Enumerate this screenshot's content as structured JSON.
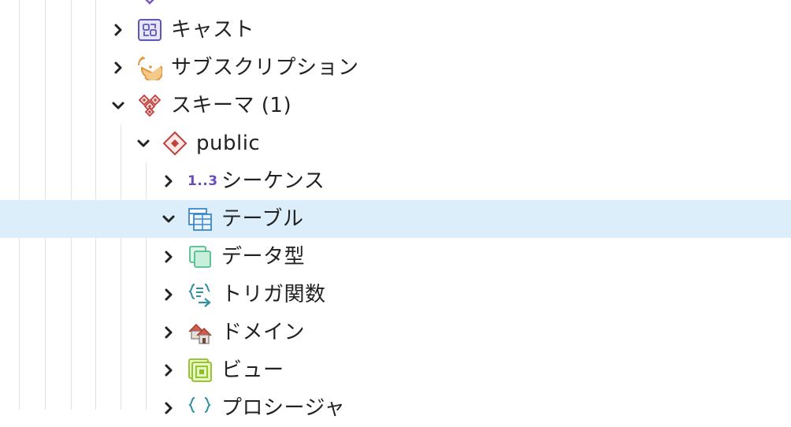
{
  "tree": {
    "items": [
      {
        "label": "キャスト",
        "icon": "cast-icon",
        "expanded": false
      },
      {
        "label": "サブスクリプション",
        "icon": "subscription-icon",
        "expanded": false
      },
      {
        "label": "スキーマ (1)",
        "icon": "schemas-icon",
        "expanded": true
      },
      {
        "label": "public",
        "icon": "schema-icon",
        "expanded": true
      },
      {
        "label": "シーケンス",
        "icon": "sequence-icon",
        "icon_text": "1..3",
        "expanded": false
      },
      {
        "label": "テーブル",
        "icon": "table-icon",
        "expanded": true,
        "selected": true
      },
      {
        "label": "データ型",
        "icon": "datatype-icon",
        "expanded": false
      },
      {
        "label": "トリガ関数",
        "icon": "trigger-function-icon",
        "expanded": false
      },
      {
        "label": "ドメイン",
        "icon": "domain-icon",
        "expanded": false
      },
      {
        "label": "ビュー",
        "icon": "view-icon",
        "expanded": false
      },
      {
        "label": "プロシージャ",
        "icon": "procedure-icon",
        "expanded": false
      }
    ]
  },
  "colors": {
    "selected_bg": "#dbeefa",
    "guide": "#e3e3e3",
    "sequence_icon": "#6a4dbb",
    "schema_icon": "#c0403c"
  }
}
